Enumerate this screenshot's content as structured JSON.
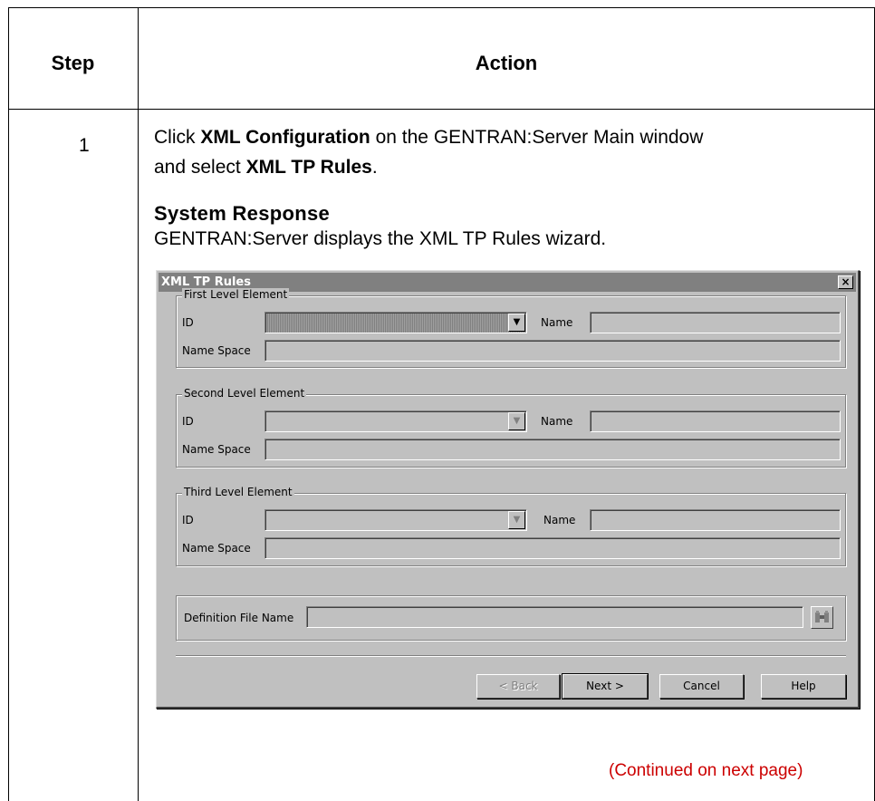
{
  "table": {
    "header": {
      "step": "Step",
      "action": "Action"
    },
    "row": {
      "step": "1",
      "instruction": {
        "part1": "Click ",
        "bold1": "XML Configuration",
        "part2": " on the GENTRAN:Server Main window",
        "part3": "and select ",
        "bold2": "XML TP Rules",
        "part4": "."
      },
      "system_response_title": "System Response",
      "system_response_text": "GENTRAN:Server displays the XML TP Rules wizard."
    },
    "continued": "(Continued on next page)"
  },
  "dialog": {
    "title": "XML TP Rules",
    "close_label": "×",
    "groups": [
      {
        "legend": "First Level Element",
        "id_label": "ID",
        "name_label": "Name",
        "namespace_label": "Name Space",
        "id_value": "",
        "name_value": "",
        "namespace_value": ""
      },
      {
        "legend": "Second Level Element",
        "id_label": "ID",
        "name_label": "Name",
        "namespace_label": "Name Space",
        "id_value": "",
        "name_value": "",
        "namespace_value": ""
      },
      {
        "legend": "Third Level Element",
        "id_label": "ID",
        "name_label": "Name",
        "namespace_label": "Name Space",
        "id_value": "",
        "name_value": "",
        "namespace_value": ""
      }
    ],
    "definition_file": {
      "label": "Definition File Name",
      "value": "",
      "browse_icon": "binoculars-icon"
    },
    "buttons": {
      "back": "< Back",
      "next": "Next >",
      "cancel": "Cancel",
      "help": "Help"
    }
  }
}
